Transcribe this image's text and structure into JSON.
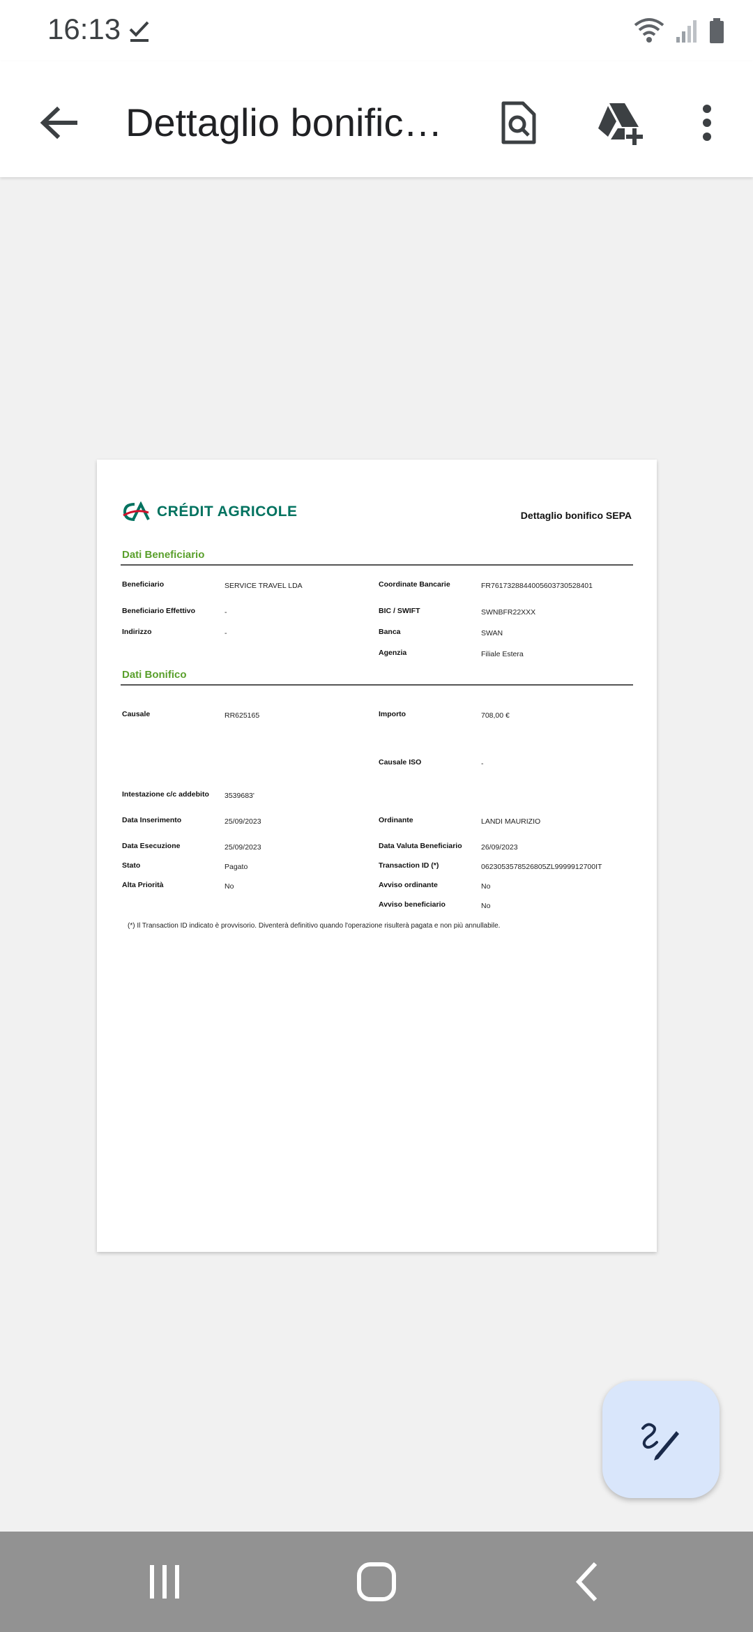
{
  "status": {
    "time": "16:13"
  },
  "appbar": {
    "title": "Dettaglio bonifico SEPA.pdf",
    "icons": [
      "back-arrow-icon",
      "file-search-icon",
      "drive-add-icon",
      "more-vert-icon"
    ]
  },
  "document": {
    "logo_text": "CRÉDIT AGRICOLE",
    "title": "Dettaglio bonifico SEPA",
    "section_beneficiario": "Dati Beneficiario",
    "section_bonifico": "Dati Bonifico",
    "beneficiario": {
      "beneficiario_label": "Beneficiario",
      "beneficiario_value": "SERVICE TRAVEL LDA",
      "coordinate_label": "Coordinate Bancarie",
      "coordinate_value": "FR7617328844005603730528401",
      "effettivo_label": "Beneficiario Effettivo",
      "effettivo_value": "-",
      "bic_label": "BIC / SWIFT",
      "bic_value": "SWNBFR22XXX",
      "indirizzo_label": "Indirizzo",
      "indirizzo_value": "-",
      "banca_label": "Banca",
      "banca_value": "SWAN",
      "agenzia_label": "Agenzia",
      "agenzia_value": "Filiale Estera"
    },
    "bonifico": {
      "causale_label": "Causale",
      "causale_value": "RR625165",
      "importo_label": "Importo",
      "importo_value": "708,00 €",
      "causale_iso_label": "Causale ISO",
      "causale_iso_value": "-",
      "intestazione_label": "Intestazione c/c addebito",
      "intestazione_value": "3539683'",
      "data_inserimento_label": "Data Inserimento",
      "data_inserimento_value": "25/09/2023",
      "ordinante_label": "Ordinante",
      "ordinante_value": "LANDI MAURIZIO",
      "data_esecuzione_label": "Data Esecuzione",
      "data_esecuzione_value": "25/09/2023",
      "data_valuta_label": "Data Valuta Beneficiario",
      "data_valuta_value": "26/09/2023",
      "stato_label": "Stato",
      "stato_value": "Pagato",
      "transaction_label": "Transaction ID (*)",
      "transaction_value": "0623053578526805ZL9999912700IT",
      "alta_priorita_label": "Alta Priorità",
      "alta_priorita_value": "No",
      "avviso_ordinante_label": "Avviso ordinante",
      "avviso_ordinante_value": "No",
      "avviso_beneficiario_label": "Avviso beneficiario",
      "avviso_beneficiario_value": "No"
    },
    "footnote": "(*) Il Transaction ID indicato è provvisorio. Diventerà definitivo quando l'operazione risulterà pagata e non più annullabile."
  },
  "colors": {
    "accent_green": "#5aa02c",
    "logo_green": "#00725f",
    "logo_red": "#d0102a",
    "fab_bg": "#d9e6fb",
    "nav_bg": "#929292"
  },
  "fab": {
    "icon": "edit-sign-icon"
  },
  "navbar": {
    "icons": [
      "recents-icon",
      "home-icon",
      "back-icon"
    ]
  }
}
